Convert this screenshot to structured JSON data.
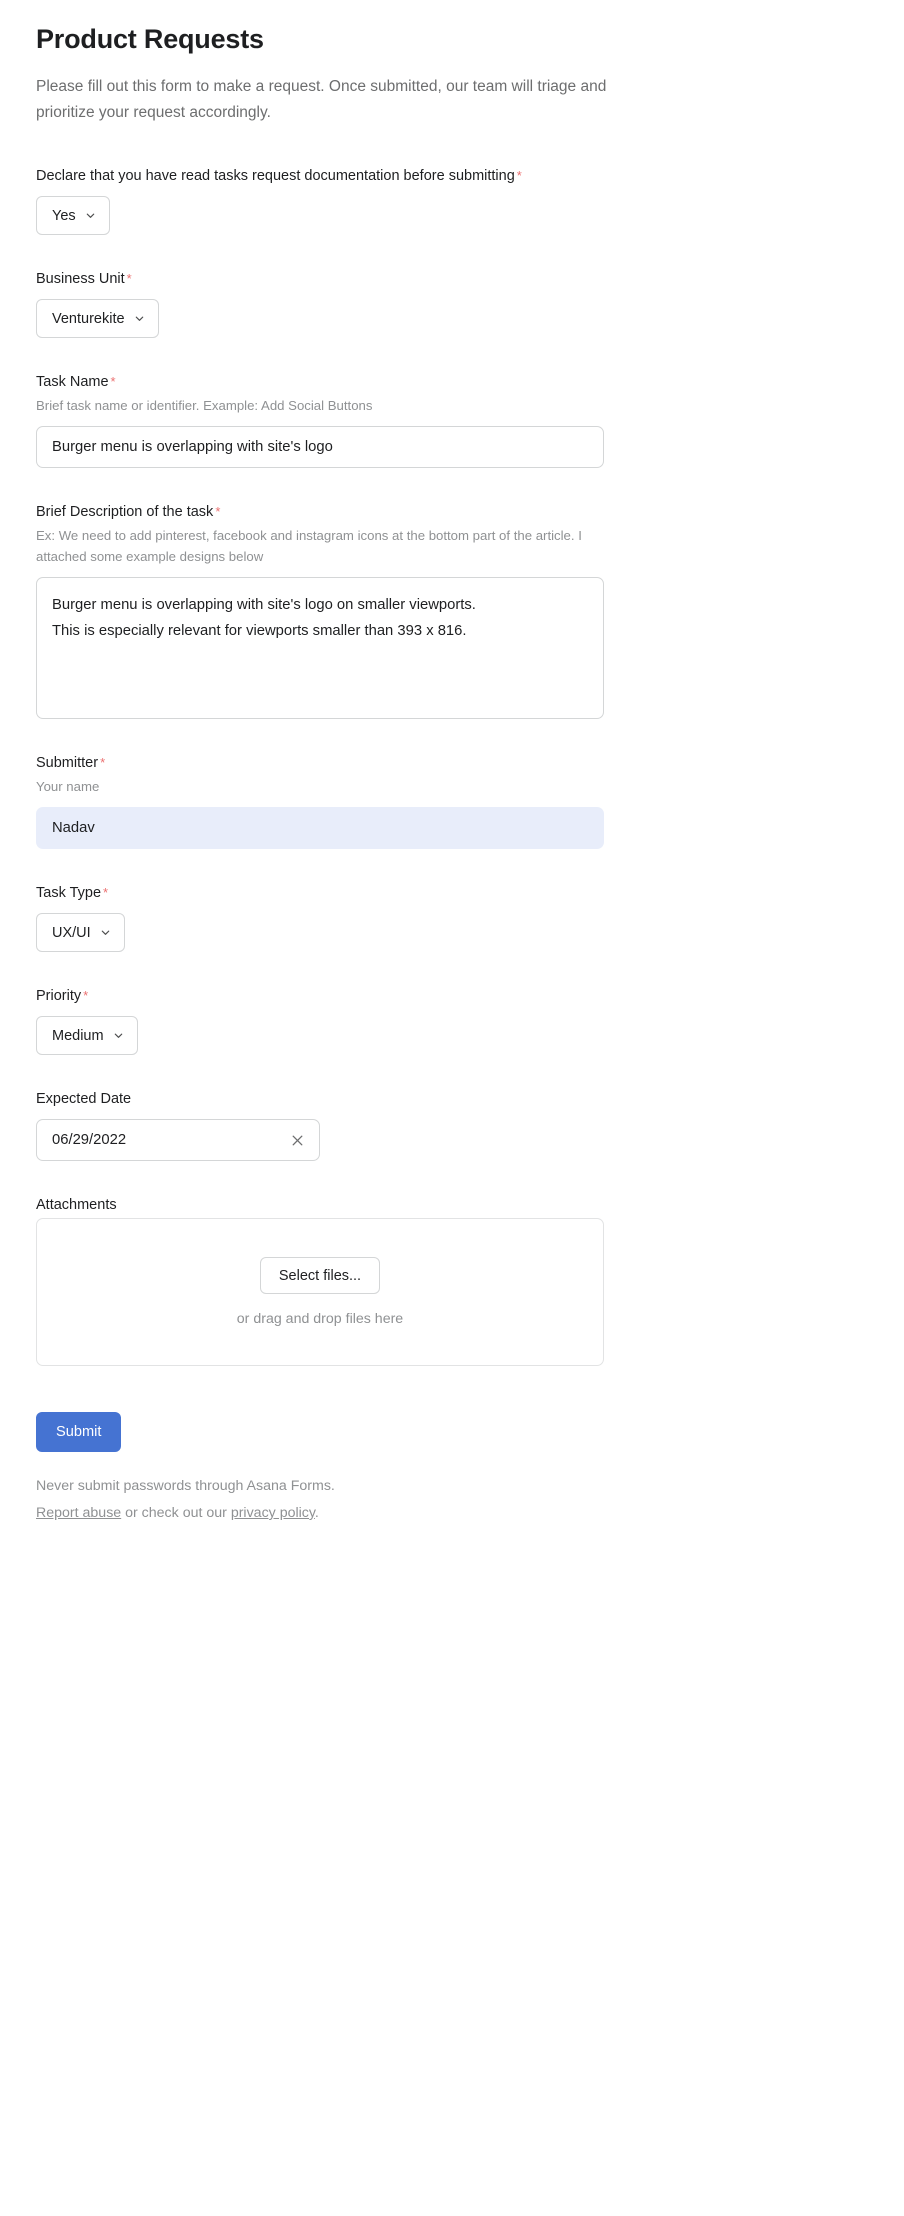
{
  "form": {
    "title": "Product Requests",
    "subtitle": "Please fill out this form to make a request. Once submitted, our team will triage and prioritize your request accordingly.",
    "required_marker": "*",
    "accent_color": "#4573D2",
    "required_color": "#EB7070",
    "highlight_field_color": "#E8EDFA"
  },
  "fields": {
    "declaration": {
      "label": "Declare that you have read tasks request documentation before submitting",
      "required": true,
      "type": "select",
      "value": "Yes",
      "icon": "chevron-down-icon"
    },
    "business_unit": {
      "label": "Business Unit",
      "required": true,
      "type": "select",
      "value": "Venturekite",
      "icon": "chevron-down-icon"
    },
    "task_name": {
      "label": "Task Name",
      "required": true,
      "help": "Brief task name or identifier. Example: Add Social Buttons",
      "type": "text",
      "value": "Burger menu is overlapping with site's logo",
      "placeholder": ""
    },
    "description": {
      "label": "Brief Description of the task",
      "required": true,
      "help": "Ex: We need to add pinterest, facebook and instagram icons at the bottom part of the article. I attached some example designs below",
      "type": "textarea",
      "value": "Burger menu is overlapping with site's logo on smaller viewports.\nThis is especially relevant for viewports smaller than 393 x 816.",
      "placeholder": ""
    },
    "submitter": {
      "label": "Submitter",
      "required": true,
      "help": "Your name",
      "type": "text",
      "value": "Nadav",
      "placeholder": "",
      "highlighted": true
    },
    "task_type": {
      "label": "Task Type",
      "required": true,
      "type": "select",
      "value": "UX/UI",
      "icon": "chevron-down-icon"
    },
    "priority": {
      "label": "Priority",
      "required": true,
      "type": "select",
      "value": "Medium",
      "icon": "chevron-down-icon"
    },
    "expected_date": {
      "label": "Expected Date",
      "required": false,
      "type": "date",
      "value": "06/29/2022",
      "clear_icon": "close-x-icon"
    },
    "attachments": {
      "label": "Attachments",
      "required": false,
      "type": "file",
      "select_button": "Select files...",
      "drag_hint": "or drag and drop files here"
    }
  },
  "footer": {
    "submit_label": "Submit",
    "notice": "Never submit passwords through Asana Forms.",
    "report_abuse_link": "Report abuse",
    "middle_text": " or check out our ",
    "privacy_link": "privacy policy",
    "period": "."
  }
}
